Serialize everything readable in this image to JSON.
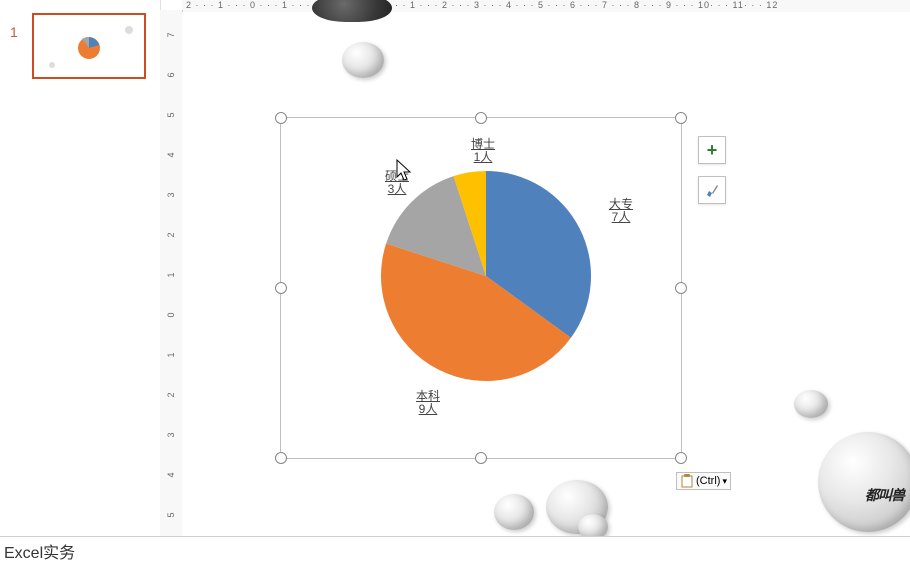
{
  "slide_number": "1",
  "bottom_text": "Excel实务",
  "paste_options_label": "(Ctrl)",
  "chart_data": {
    "type": "pie",
    "title": "",
    "series": [
      {
        "name": "大专",
        "value": 7,
        "label": "大专",
        "count_label": "7人",
        "color": "#4f81bd"
      },
      {
        "name": "本科",
        "value": 9,
        "label": "本科",
        "count_label": "9人",
        "color": "#ed7d31"
      },
      {
        "name": "硕士",
        "value": 3,
        "label": "硕士",
        "count_label": "3人",
        "color": "#a5a5a5"
      },
      {
        "name": "博士",
        "value": 1,
        "label": "博士",
        "count_label": "1人",
        "color": "#ffc000"
      }
    ]
  },
  "ruler_h": "2 · · · 1 · · · 0 · · · 1 · · · 2 · · · 1 · · · 0 · · · 1 · · · 2 · · · 3 · · · 4 · · · 5 · · · 6 · · · 7 · · · 8 · · · 9 · · · 10· · · 11· · · 12",
  "ruler_v": [
    "7",
    "6",
    "5",
    "4",
    "3",
    "2",
    "1",
    "0",
    "1",
    "2",
    "3",
    "4",
    "5"
  ],
  "watermark": "都叫兽"
}
